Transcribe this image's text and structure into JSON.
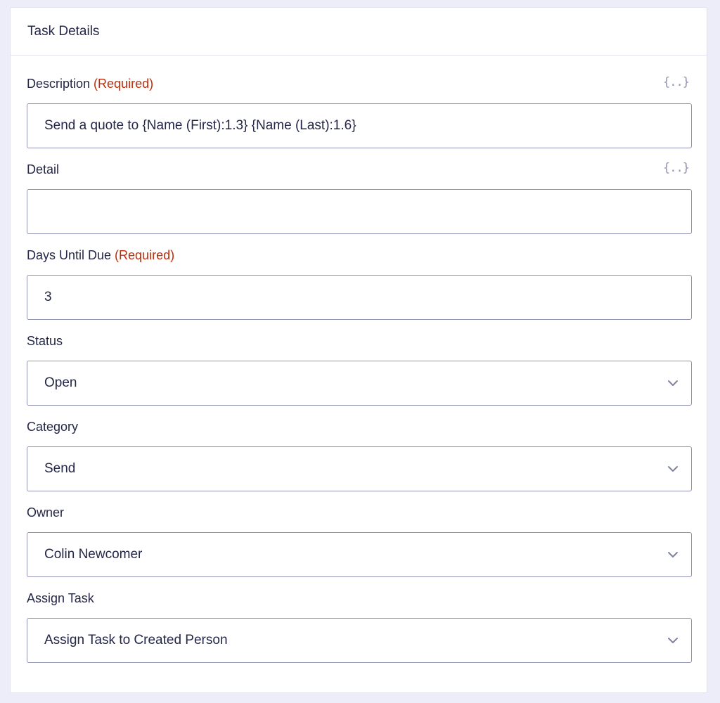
{
  "header": {
    "title": "Task Details"
  },
  "required_text": "(Required)",
  "fields": {
    "description": {
      "label": "Description",
      "value": "Send a quote to {Name (First):1.3} {Name (Last):1.6}",
      "merge_tag": "{..}"
    },
    "detail": {
      "label": "Detail",
      "value": "",
      "merge_tag": "{..}"
    },
    "days_until_due": {
      "label": "Days Until Due",
      "value": "3"
    },
    "status": {
      "label": "Status",
      "selected": "Open"
    },
    "category": {
      "label": "Category",
      "selected": "Send"
    },
    "owner": {
      "label": "Owner",
      "selected": "Colin Newcomer"
    },
    "assign_task": {
      "label": "Assign Task",
      "selected": "Assign Task to Created Person"
    }
  },
  "icons": {
    "merge_tag": "merge-tags-icon",
    "dropdown": "chevron-down-icon"
  },
  "colors": {
    "required": "#c02b0a",
    "border": "#9092b2",
    "text": "#242748"
  }
}
